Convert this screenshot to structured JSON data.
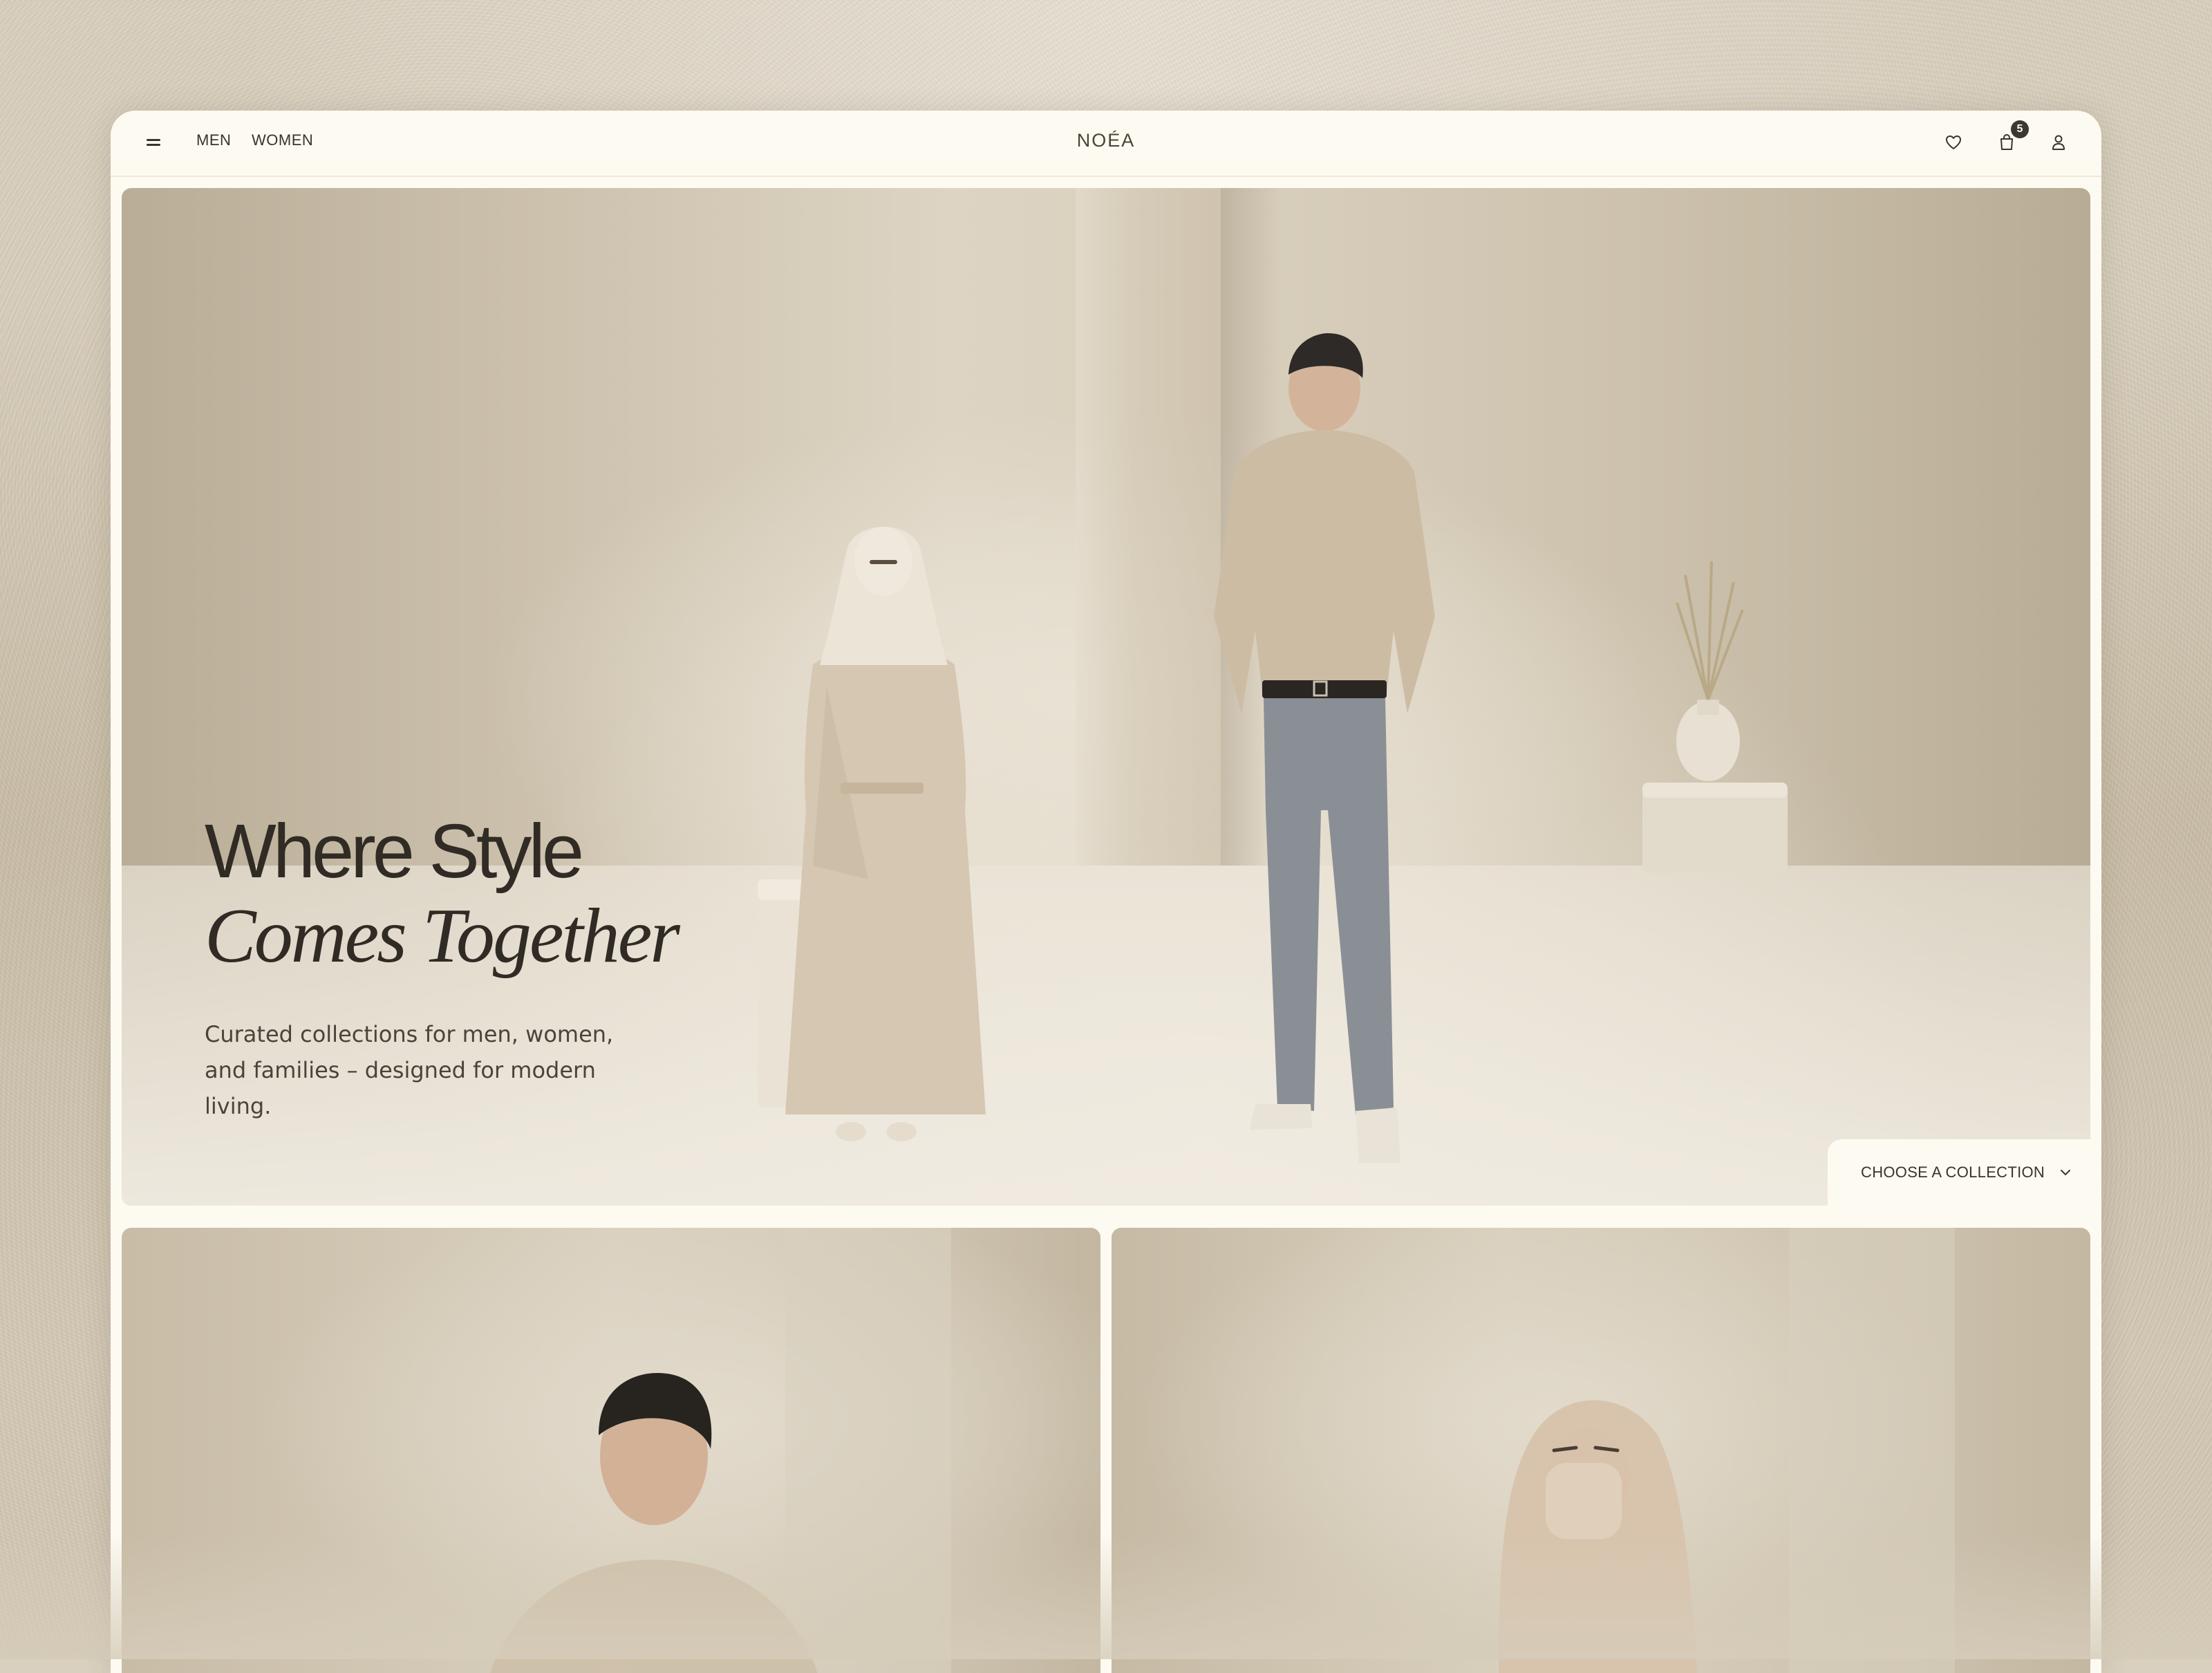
{
  "header": {
    "nav": [
      "MEN",
      "WOMEN"
    ],
    "logo": "NOÉA",
    "cart_count": "5",
    "icons": [
      "menu-icon",
      "heart-icon",
      "shopping-bag-icon",
      "user-icon"
    ]
  },
  "hero": {
    "title_line1": "Where Style",
    "title_line2": "Comes Together",
    "subtitle": "Curated collections for men, women, and families – designed for modern living.",
    "image": "hero-couple-photo"
  },
  "collection_select": {
    "label": "CHOOSE A COLLECTION"
  },
  "cards": [
    {
      "image": "men-collection-photo"
    },
    {
      "image": "women-collection-photo"
    }
  ],
  "colors": {
    "background": "#d6ccba",
    "frame": "#fcfaf1",
    "text_dark": "#302b24",
    "badge": "#3d372f"
  }
}
